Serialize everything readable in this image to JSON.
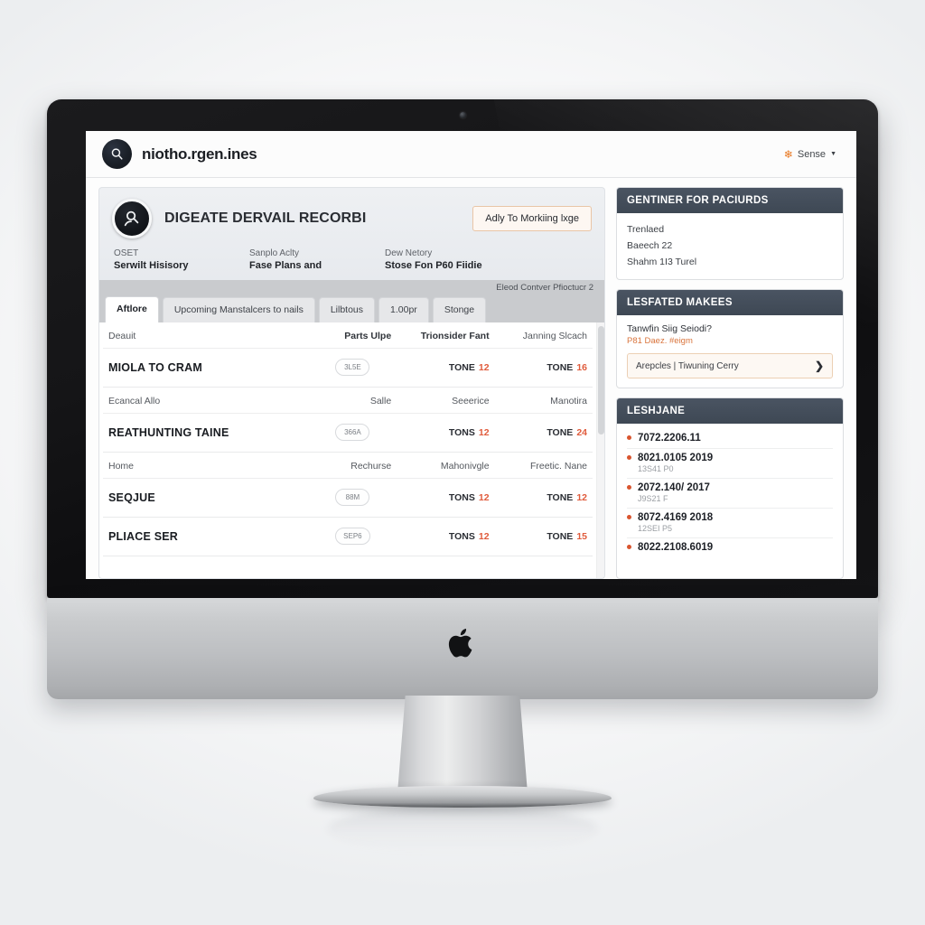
{
  "topbar": {
    "brand_name": "niotho.rgen.ines",
    "brand_icon": "search-badge-icon",
    "account_label": "Sense",
    "account_leaf_icon": "maple-leaf-icon",
    "caret_icon": "chevron-down-icon"
  },
  "hero": {
    "avatar_icon": "search-person-icon",
    "title": "DIGEATE DERVAIL RECORBI",
    "action_label": "Adly To Morkiing lxge",
    "meta": [
      {
        "key": "OSET",
        "value": "Serwilt Hisisory"
      },
      {
        "key": "Sanplo Aclty",
        "value": "Fase Plans and"
      },
      {
        "key": "Dew Netory",
        "value": "Stose Fon P60 Fiidie"
      }
    ]
  },
  "tabstrip": {
    "note": "Eleod Contver Pfioctucr 2",
    "tabs": [
      {
        "label": "Aftlore",
        "active": true
      },
      {
        "label": "Upcoming Manstalcers to nails",
        "active": false
      },
      {
        "label": "Lilbtous",
        "active": false
      },
      {
        "label": "1.00pr",
        "active": false
      },
      {
        "label": "Stonge",
        "active": false
      }
    ]
  },
  "table": {
    "groups": [
      {
        "headers": [
          "Deauit",
          "Parts Ulpe",
          "Trionsider Fant",
          "Janning Slcach"
        ],
        "header_bold": [
          false,
          true,
          true,
          false
        ],
        "row": {
          "name": "MIOLA TO CRAM",
          "pill": "3L5E",
          "tone1_label": "TONE",
          "tone1_value": "12",
          "tone2_label": "TONE",
          "tone2_value": "16"
        }
      },
      {
        "headers": [
          "Ecancal Allo",
          "Salle",
          "Seeerice",
          "Manotira"
        ],
        "header_bold": [
          false,
          false,
          false,
          false
        ],
        "row": {
          "name": "REATHUNTING TAINE",
          "pill": "366A",
          "tone1_label": "TONS",
          "tone1_value": "12",
          "tone2_label": "TONE",
          "tone2_value": "24"
        }
      },
      {
        "headers": [
          "Home",
          "Rechurse",
          "Mahonivgle",
          "Freetic. Nane"
        ],
        "header_bold": [
          false,
          false,
          false,
          false
        ],
        "row": {
          "name": "SEQJUE",
          "pill": "88M",
          "tone1_label": "TONS",
          "tone1_value": "12",
          "tone2_label": "TONE",
          "tone2_value": "12"
        }
      },
      {
        "headers": [
          "",
          "",
          "",
          ""
        ],
        "header_bold": [
          false,
          false,
          false,
          false
        ],
        "row": {
          "name": "PLIACE SER",
          "pill": "SEP6",
          "tone1_label": "TONS",
          "tone1_value": "12",
          "tone2_label": "TONE",
          "tone2_value": "15"
        }
      }
    ]
  },
  "sidebar": {
    "card_info": {
      "title": "GENTINER FOR PACIURDS",
      "lines": [
        "Trenlaed",
        "Baeech 22",
        "Shahm 1I3 Turel"
      ]
    },
    "card_makes": {
      "title": "LESFATED MAKEES",
      "question": "Tanwfin Siig Seiodi?",
      "answer": "P81 Daez. #eigm",
      "button_label": "Arepcles | Tiwuning Cerry",
      "button_arrow_icon": "chevron-right-icon"
    },
    "card_list": {
      "title": "LESHJANE",
      "items": [
        {
          "title": "7072.2206.11",
          "sub": ""
        },
        {
          "title": "8021.0105 2019",
          "sub": "13S41 P0"
        },
        {
          "title": "2072.140/ 2017",
          "sub": "J9S21 F"
        },
        {
          "title": "8072.4169 2018",
          "sub": "12SEI P5"
        },
        {
          "title": "8022.2108.6019",
          "sub": ""
        }
      ]
    }
  },
  "hardware": {
    "apple_logo_icon": "apple-logo-icon",
    "camera_icon": "webcam-icon"
  },
  "colors": {
    "accent_orange": "#e05b3c",
    "card_header": "#3e4854",
    "brand_dark": "#14171c"
  }
}
